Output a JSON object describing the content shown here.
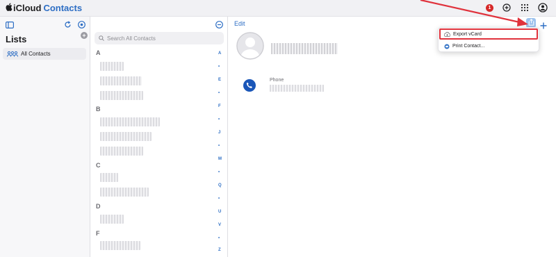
{
  "app": {
    "brand_prefix": "iCloud",
    "brand_name": "Contacts"
  },
  "topbar": {
    "notification_count": "1"
  },
  "lists": {
    "title": "Lists",
    "items": [
      {
        "label": "All Contacts"
      }
    ]
  },
  "contacts": {
    "search_placeholder": "Search All Contacts",
    "sections": [
      "A",
      "B",
      "C",
      "D",
      "F"
    ],
    "index": [
      "A",
      "•",
      "E",
      "•",
      "F",
      "•",
      "J",
      "•",
      "M",
      "•",
      "Q",
      "•",
      "U",
      "V",
      "•",
      "Z",
      "#"
    ]
  },
  "detail": {
    "edit_label": "Edit",
    "phone_label": "Phone"
  },
  "share_menu": {
    "items": [
      {
        "label": "Export vCard"
      },
      {
        "label": "Print Contact..."
      }
    ]
  },
  "colors": {
    "accent": "#2d6ec4",
    "highlight": "#e0323c",
    "phone": "#1a56b8"
  },
  "icons": {
    "apple": "apple-logo-icon",
    "badge": "notification-badge",
    "add_circle": "add-circle-icon",
    "grid": "app-grid-icon",
    "account": "account-icon",
    "sidebar": "sidebar-toggle-icon",
    "refresh": "refresh-icon",
    "settings": "settings-icon",
    "people": "people-icon",
    "search": "search-icon",
    "more": "more-icon",
    "avatar": "avatar-icon",
    "phone": "phone-icon",
    "share": "share-icon",
    "add": "add-icon",
    "export": "cloud-download-icon",
    "print": "printer-icon"
  }
}
